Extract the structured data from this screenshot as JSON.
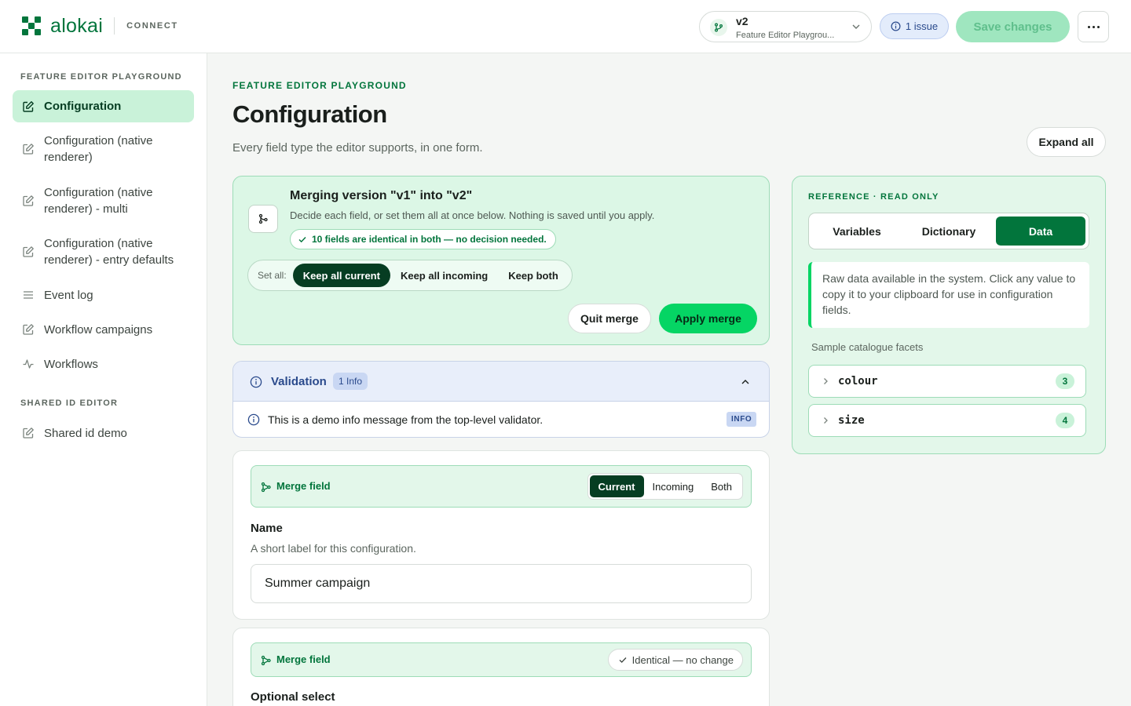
{
  "header": {
    "logo_text": "alokai",
    "logo_sub": "CONNECT",
    "version": {
      "title": "v2",
      "subtitle": "Feature Editor Playground"
    },
    "issue_badge": "1 issue",
    "save_label": "Save changes",
    "more_icon": "more-horizontal-icon"
  },
  "sidebar": {
    "section1": "FEATURE EDITOR PLAYGROUND",
    "items": [
      {
        "label": "Configuration",
        "icon": "edit-icon"
      },
      {
        "label": "Configuration (native renderer)",
        "icon": "edit-icon"
      },
      {
        "label": "Configuration (native renderer) - multi",
        "icon": "edit-icon"
      },
      {
        "label": "Configuration (native renderer) - entry defaults",
        "icon": "edit-icon"
      },
      {
        "label": "Event log",
        "icon": "list-icon"
      },
      {
        "label": "Workflow campaigns",
        "icon": "edit-icon"
      },
      {
        "label": "Workflows",
        "icon": "activity-icon"
      }
    ],
    "section2": "SHARED ID EDITOR",
    "items2": [
      {
        "label": "Shared id demo",
        "icon": "edit-icon"
      }
    ]
  },
  "main": {
    "eyebrow": "FEATURE EDITOR PLAYGROUND",
    "title": "Configuration",
    "description": "Every field type the editor supports, in one form.",
    "expand_all": "Expand all"
  },
  "merge": {
    "title": "Merging version \"v1\" into \"v2\"",
    "description": "Decide each field, or set them all at once below. Nothing is saved until you apply.",
    "identical_chip": "10 fields are identical in both — no decision needed.",
    "set_all_label": "Set all:",
    "set_all_options": [
      "Keep all current",
      "Keep all incoming",
      "Keep both"
    ],
    "set_all_selected": "Keep all current",
    "quit": "Quit merge",
    "apply": "Apply merge"
  },
  "validation": {
    "title": "Validation",
    "count": "1 Info",
    "message": "This is a demo info message from the top-level validator.",
    "tag": "INFO"
  },
  "fields": [
    {
      "merge_label": "Merge field",
      "options": [
        "Current",
        "Incoming",
        "Both"
      ],
      "selected": "Current",
      "label": "Name",
      "help": "A short label for this configuration.",
      "value": "Summer campaign"
    },
    {
      "merge_label": "Merge field",
      "status": "Identical — no change",
      "label": "Optional select"
    }
  ],
  "reference": {
    "eyebrow": "REFERENCE · READ ONLY",
    "tabs": [
      "Variables",
      "Dictionary",
      "Data"
    ],
    "active_tab": "Data",
    "note": "Raw data available in the system. Click any value to copy it to your clipboard for use in configuration fields.",
    "subheading": "Sample catalogue facets",
    "facets": [
      {
        "name": "colour",
        "count": "3"
      },
      {
        "name": "size",
        "count": "4"
      }
    ]
  },
  "colors": {
    "brand": "#02753c",
    "accent": "#05d564",
    "info": "#2a4a8c"
  }
}
